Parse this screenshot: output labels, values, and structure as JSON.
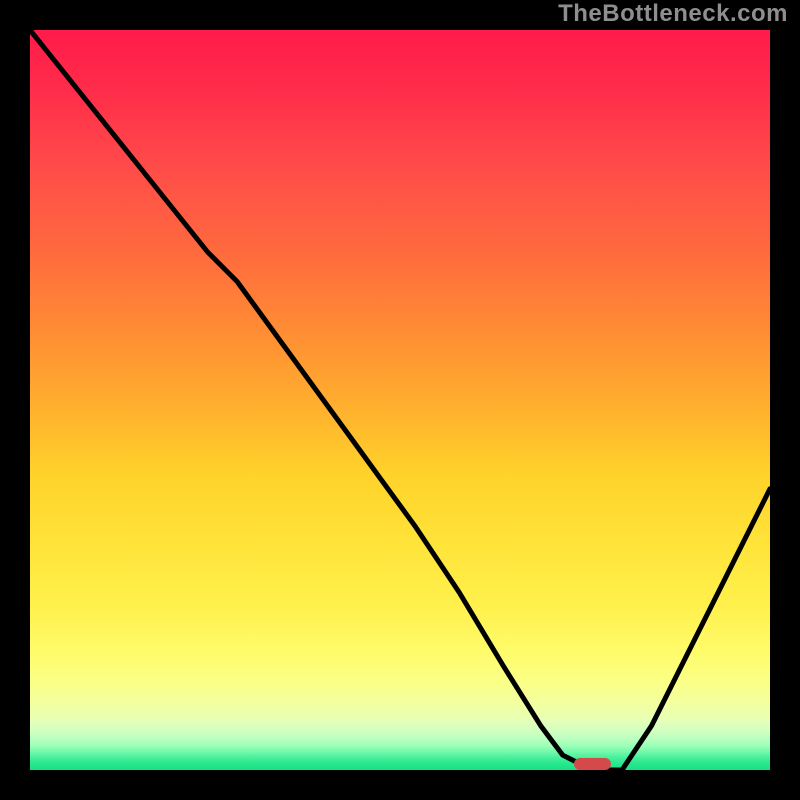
{
  "watermark": "TheBottleneck.com",
  "colors": {
    "background": "#000000",
    "curve": "#000000",
    "marker": "#d44a4a"
  },
  "chart_data": {
    "type": "line",
    "title": "",
    "xlabel": "",
    "ylabel": "",
    "xlim": [
      0,
      100
    ],
    "ylim": [
      0,
      100
    ],
    "grid": false,
    "legend": false,
    "series": [
      {
        "name": "bottleneck-curve",
        "x": [
          0,
          8,
          16,
          24,
          28,
          36,
          44,
          52,
          58,
          64,
          69,
          72,
          76,
          80,
          84,
          88,
          92,
          96,
          100
        ],
        "y": [
          100,
          90,
          80,
          70,
          66,
          55,
          44,
          33,
          24,
          14,
          6,
          2,
          0,
          0,
          6,
          14,
          22,
          30,
          38
        ]
      }
    ],
    "annotations": [
      {
        "name": "optimal-marker",
        "shape": "pill",
        "x": 76,
        "y": 0,
        "width_pct": 5,
        "height_pct": 1.6
      }
    ],
    "background_gradient_stops": [
      {
        "pos": 0,
        "color": "#ff1b4a"
      },
      {
        "pos": 50,
        "color": "#ffd22a"
      },
      {
        "pos": 88,
        "color": "#f3ffa0"
      },
      {
        "pos": 100,
        "color": "#18e085"
      }
    ]
  }
}
